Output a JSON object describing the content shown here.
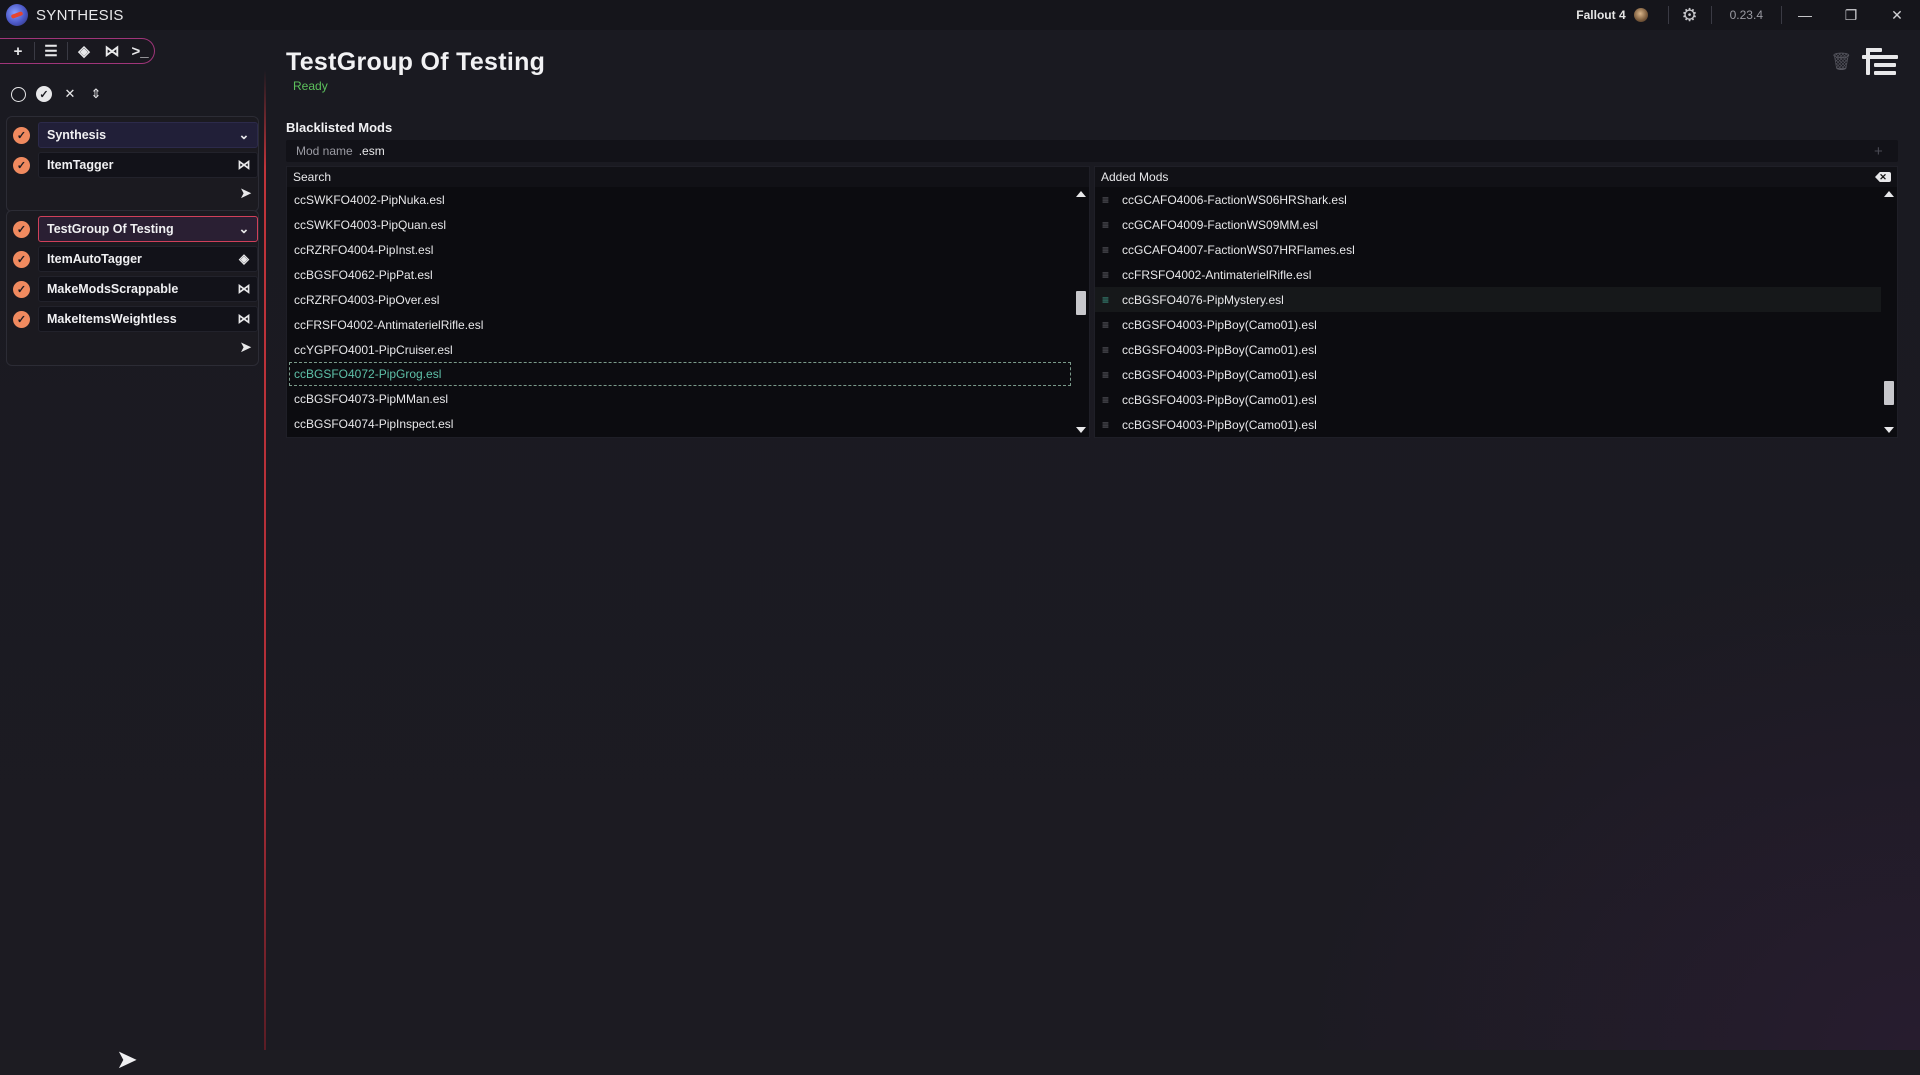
{
  "window": {
    "app_title": "SYNTHESIS",
    "game": "Fallout 4",
    "version": "0.23.4",
    "controls": {
      "minimize": "—",
      "restore": "❐",
      "close": "✕"
    }
  },
  "sidebar": {
    "toolbar": [
      "add-icon",
      "list-icon",
      "git-icon",
      "visual-studio-icon",
      "terminal-icon"
    ],
    "selection_tools": [
      "deselect-all-icon",
      "select-all-icon",
      "clear-icon",
      "collapse-icon"
    ],
    "groups": [
      {
        "name": "Synthesis",
        "enabled": true,
        "patchers": [
          {
            "name": "ItemTagger",
            "icon": "visual-studio-icon"
          }
        ]
      },
      {
        "name": "TestGroup Of Testing",
        "enabled": true,
        "selected": true,
        "patchers": [
          {
            "name": "ItemAutoTagger",
            "icon": "git-icon"
          },
          {
            "name": "MakeModsScrappable",
            "icon": "visual-studio-icon"
          },
          {
            "name": "MakeItemsWeightless",
            "icon": "visual-studio-icon"
          }
        ]
      }
    ]
  },
  "main": {
    "title": "TestGroup Of Testing",
    "status": "Ready",
    "section_title": "Blacklisted Mods",
    "mod_name_label": "Mod name",
    "mod_name_value": ".esm",
    "search_header": "Search",
    "added_header": "Added Mods",
    "search_list": [
      "ccSWKFO4002-PipNuka.esl",
      "ccSWKFO4003-PipQuan.esl",
      "ccRZRFO4004-PipInst.esl",
      "ccBGSFO4062-PipPat.esl",
      "ccRZRFO4003-PipOver.esl",
      "ccFRSFO4002-AntimaterielRifle.esl",
      "ccYGPFO4001-PipCruiser.esl",
      "ccBGSFO4072-PipGrog.esl",
      "ccBGSFO4073-PipMMan.esl",
      "ccBGSFO4074-PipInspect.esl"
    ],
    "search_focused_index": 7,
    "added_list": [
      "ccGCAFO4006-FactionWS06HRShark.esl",
      "ccGCAFO4009-FactionWS09MM.esl",
      "ccGCAFO4007-FactionWS07HRFlames.esl",
      "ccFRSFO4002-AntimaterielRifle.esl",
      "ccBGSFO4076-PipMystery.esl",
      "ccBGSFO4003-PipBoy(Camo01).esl",
      "ccBGSFO4003-PipBoy(Camo01).esl",
      "ccBGSFO4003-PipBoy(Camo01).esl",
      "ccBGSFO4003-PipBoy(Camo01).esl",
      "ccBGSFO4003-PipBoy(Camo01).esl"
    ],
    "added_highlight_index": 4,
    "search_scroll_position": 0.45,
    "added_scroll_position": 0.9
  },
  "colors": {
    "accent_check": "#f08a5f",
    "status_ready": "#5cc05c",
    "selection_border": "#d0405a",
    "focused_text": "#5ec0a8"
  }
}
